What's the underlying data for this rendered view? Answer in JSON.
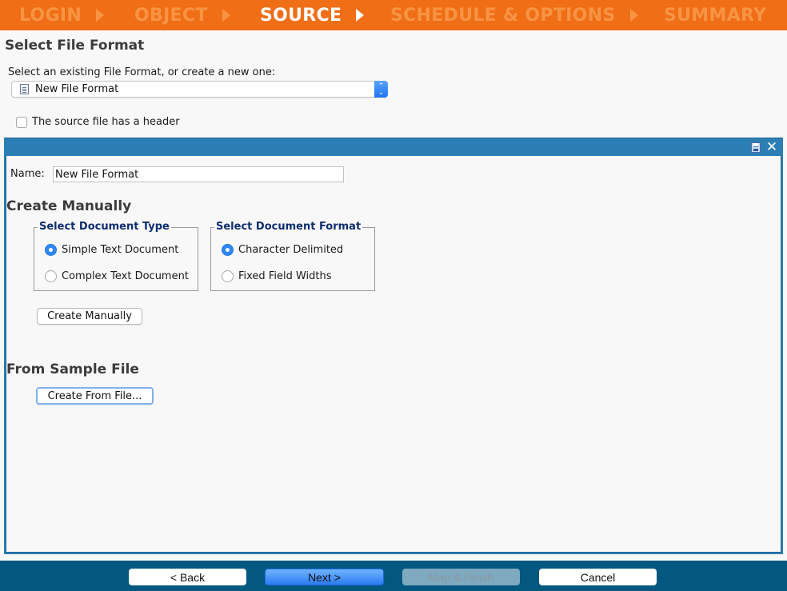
{
  "wizard": {
    "steps": [
      {
        "label": "LOGIN",
        "state": "inactive"
      },
      {
        "label": "OBJECT",
        "state": "inactive"
      },
      {
        "label": "SOURCE",
        "state": "active"
      },
      {
        "label": "SCHEDULE & OPTIONS",
        "state": "inactive"
      },
      {
        "label": "SUMMARY",
        "state": "inactive"
      }
    ]
  },
  "select_file_format": {
    "title": "Select File Format",
    "prompt": "Select an existing File Format, or create a new one:",
    "selected_value": "New File Format",
    "header_checkbox_label": "The source file has a header",
    "header_checked": false
  },
  "panel": {
    "name_label": "Name:",
    "name_value": "New File Format",
    "create_manually_heading": "Create Manually",
    "document_type": {
      "legend": "Select Document Type",
      "options": [
        {
          "label": "Simple Text Document",
          "checked": true
        },
        {
          "label": "Complex Text Document",
          "checked": false
        }
      ]
    },
    "document_format": {
      "legend": "Select Document Format",
      "options": [
        {
          "label": "Character Delimited",
          "checked": true
        },
        {
          "label": "Fixed Field Widths",
          "checked": false
        }
      ]
    },
    "create_manually_button": "Create Manually",
    "from_sample_heading": "From Sample File",
    "create_from_file_button": "Create From File...",
    "close_glyph": "✕"
  },
  "footer": {
    "back": "< Back",
    "next": "Next >",
    "map_finish": "Map & Finish",
    "map_finish_enabled": false,
    "cancel": "Cancel"
  },
  "colors": {
    "step_bar": "#f06e16",
    "step_inactive": "#f79443",
    "panel_accent": "#2c7fb5",
    "footer_bg": "#02587f",
    "primary_button": "#2b7cf2",
    "legend_text": "#0f2e6e"
  }
}
